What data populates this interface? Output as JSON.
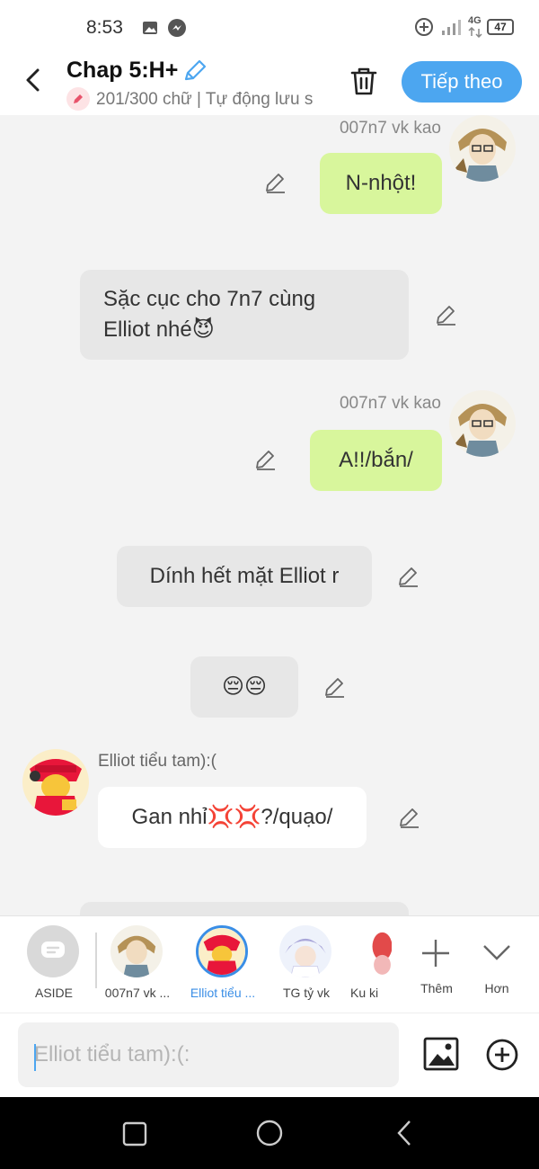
{
  "status_bar": {
    "time": "8:53",
    "network": "4G",
    "battery": "47"
  },
  "header": {
    "title": "Chap 5:H+",
    "word_count": "201/300 chữ | Tự động lưu s",
    "next_label": "Tiếp theo"
  },
  "messages": [
    {
      "sender": "007n7 vk kao",
      "text": "N-nhột!"
    },
    {
      "sender": "",
      "text_lines": [
        "Sặc cục cho 7n7 cùng",
        "Elliot nhé😈"
      ]
    },
    {
      "sender": "007n7 vk kao",
      "text": "A!!/bắn/"
    },
    {
      "sender": "",
      "text": "Dính hết mặt Elliot r"
    },
    {
      "sender": "",
      "text": "😔😔"
    },
    {
      "sender": "Elliot tiểu tam):(",
      "text": "Gan nhỉ💢💢?/quạo/"
    }
  ],
  "characters": [
    {
      "label": "ASIDE"
    },
    {
      "label": "007n7 vk ..."
    },
    {
      "label": "Elliot tiểu ..."
    },
    {
      "label": "TG tỷ vk"
    },
    {
      "label": "Ku ki"
    },
    {
      "label": "Thêm"
    },
    {
      "label": "Hơn"
    }
  ],
  "input": {
    "placeholder": "Elliot tiểu tam):(:"
  },
  "colors": {
    "accent": "#4ca6f0",
    "green_bubble": "#d8f69c",
    "gray_bubble": "#e7e7e7",
    "selected_label": "#3a8ee6"
  },
  "icons": [
    "back-icon",
    "edit-pencil-icon",
    "trash-icon",
    "image-icon",
    "add-circle-icon",
    "plus-icon",
    "chevron-down-icon",
    "home-icon",
    "recent-apps-icon",
    "nav-back-icon"
  ]
}
